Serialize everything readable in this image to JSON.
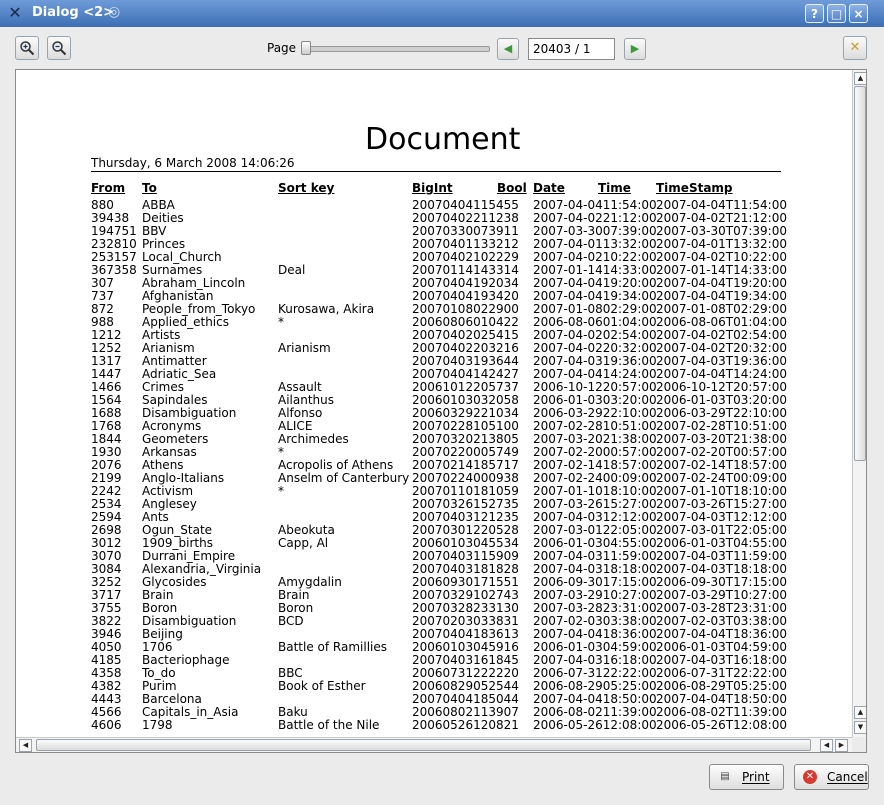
{
  "window": {
    "title": "Dialog <2>",
    "controls": [
      "?",
      "□",
      "×"
    ]
  },
  "toolbar": {
    "zoom_in_icon": "magnifier-plus-icon",
    "zoom_out_icon": "magnifier-minus-icon",
    "page_label": "Page",
    "page_value": "20403 / 1",
    "page_position": 0.0
  },
  "document": {
    "title": "Document",
    "date": "Thursday, 6 March 2008  14:06:26",
    "headers": {
      "from": "From",
      "to": "To",
      "sort": "Sort key",
      "bigint": "BigInt",
      "bool": "Bool",
      "date": "Date",
      "time": "Time",
      "timestamp": "TimeStamp"
    },
    "rows": [
      [
        "880",
        "ABBA",
        "",
        "20070404115455",
        "2007-04-0411:54:00",
        "2007-04-04T11:54:00"
      ],
      [
        "39438",
        "Deities",
        "",
        "20070402211238",
        "2007-04-0221:12:00",
        "2007-04-02T21:12:00"
      ],
      [
        "194751",
        "BBV",
        "",
        "20070330073911",
        "2007-03-3007:39:00",
        "2007-03-30T07:39:00"
      ],
      [
        "232810",
        "Princes",
        "",
        "20070401133212",
        "2007-04-0113:32:00",
        "2007-04-01T13:32:00"
      ],
      [
        "253157",
        "Local_Church",
        "",
        "20070402102229",
        "2007-04-0210:22:00",
        "2007-04-02T10:22:00"
      ],
      [
        "367358",
        "Surnames",
        "Deal",
        "20070114143314",
        "2007-01-1414:33:00",
        "2007-01-14T14:33:00"
      ],
      [
        "307",
        "Abraham_Lincoln",
        "",
        "20070404192034",
        "2007-04-0419:20:00",
        "2007-04-04T19:20:00"
      ],
      [
        "737",
        "Afghanistan",
        "",
        "20070404193420",
        "2007-04-0419:34:00",
        "2007-04-04T19:34:00"
      ],
      [
        "872",
        "People_from_Tokyo",
        "Kurosawa, Akira",
        "20070108022900",
        "2007-01-0802:29:00",
        "2007-01-08T02:29:00"
      ],
      [
        "988",
        "Applied_ethics",
        "*",
        "20060806010422",
        "2006-08-0601:04:00",
        "2006-08-06T01:04:00"
      ],
      [
        "1212",
        "Artists",
        "",
        "20070402025415",
        "2007-04-0202:54:00",
        "2007-04-02T02:54:00"
      ],
      [
        "1252",
        "Arianism",
        "Arianism",
        "20070402203216",
        "2007-04-0220:32:00",
        "2007-04-02T20:32:00"
      ],
      [
        "1317",
        "Antimatter",
        "",
        "20070403193644",
        "2007-04-0319:36:00",
        "2007-04-03T19:36:00"
      ],
      [
        "1447",
        "Adriatic_Sea",
        "",
        "20070404142427",
        "2007-04-0414:24:00",
        "2007-04-04T14:24:00"
      ],
      [
        "1466",
        "Crimes",
        "Assault",
        "20061012205737",
        "2006-10-1220:57:00",
        "2006-10-12T20:57:00"
      ],
      [
        "1564",
        "Sapindales",
        "Ailanthus",
        "20060103032058",
        "2006-01-0303:20:00",
        "2006-01-03T03:20:00"
      ],
      [
        "1688",
        "Disambiguation",
        "Alfonso",
        "20060329221034",
        "2006-03-2922:10:00",
        "2006-03-29T22:10:00"
      ],
      [
        "1768",
        "Acronyms",
        "ALICE",
        "20070228105100",
        "2007-02-2810:51:00",
        "2007-02-28T10:51:00"
      ],
      [
        "1844",
        "Geometers",
        "Archimedes",
        "20070320213805",
        "2007-03-2021:38:00",
        "2007-03-20T21:38:00"
      ],
      [
        "1930",
        "Arkansas",
        "*",
        "20070220005749",
        "2007-02-2000:57:00",
        "2007-02-20T00:57:00"
      ],
      [
        "2076",
        "Athens",
        "Acropolis of Athens",
        "20070214185717",
        "2007-02-1418:57:00",
        "2007-02-14T18:57:00"
      ],
      [
        "2199",
        "Anglo-Italians",
        "Anselm of Canterbury",
        "20070224000938",
        "2007-02-2400:09:00",
        "2007-02-24T00:09:00"
      ],
      [
        "2242",
        "Activism",
        "*",
        "20070110181059",
        "2007-01-1018:10:00",
        "2007-01-10T18:10:00"
      ],
      [
        "2534",
        "Anglesey",
        "",
        "20070326152735",
        "2007-03-2615:27:00",
        "2007-03-26T15:27:00"
      ],
      [
        "2594",
        "Ants",
        "",
        "20070403121235",
        "2007-04-0312:12:00",
        "2007-04-03T12:12:00"
      ],
      [
        "2698",
        "Ogun_State",
        "Abeokuta",
        "20070301220528",
        "2007-03-0122:05:00",
        "2007-03-01T22:05:00"
      ],
      [
        "3012",
        "1909_births",
        "Capp, Al",
        "20060103045534",
        "2006-01-0304:55:00",
        "2006-01-03T04:55:00"
      ],
      [
        "3070",
        "Durrani_Empire",
        "",
        "20070403115909",
        "2007-04-0311:59:00",
        "2007-04-03T11:59:00"
      ],
      [
        "3084",
        "Alexandria,_Virginia",
        "",
        "20070403181828",
        "2007-04-0318:18:00",
        "2007-04-03T18:18:00"
      ],
      [
        "3252",
        "Glycosides",
        "Amygdalin",
        "20060930171551",
        "2006-09-3017:15:00",
        "2006-09-30T17:15:00"
      ],
      [
        "3717",
        "Brain",
        "Brain",
        "20070329102743",
        "2007-03-2910:27:00",
        "2007-03-29T10:27:00"
      ],
      [
        "3755",
        "Boron",
        "Boron",
        "20070328233130",
        "2007-03-2823:31:00",
        "2007-03-28T23:31:00"
      ],
      [
        "3822",
        "Disambiguation",
        "BCD",
        "20070203033831",
        "2007-02-0303:38:00",
        "2007-02-03T03:38:00"
      ],
      [
        "3946",
        "Beijing",
        "",
        "20070404183613",
        "2007-04-0418:36:00",
        "2007-04-04T18:36:00"
      ],
      [
        "4050",
        "1706",
        "Battle of Ramillies",
        "20060103045916",
        "2006-01-0304:59:00",
        "2006-01-03T04:59:00"
      ],
      [
        "4185",
        "Bacteriophage",
        "",
        "20070403161845",
        "2007-04-0316:18:00",
        "2007-04-03T16:18:00"
      ],
      [
        "4358",
        "To_do",
        "BBC",
        "20060731222220",
        "2006-07-3122:22:00",
        "2006-07-31T22:22:00"
      ],
      [
        "4382",
        "Purim",
        "Book of Esther",
        "20060829052544",
        "2006-08-2905:25:00",
        "2006-08-29T05:25:00"
      ],
      [
        "4443",
        "Barcelona",
        "",
        "20070404185044",
        "2007-04-0418:50:00",
        "2007-04-04T18:50:00"
      ],
      [
        "4566",
        "Capitals_in_Asia",
        "Baku",
        "20060802113907",
        "2006-08-0211:39:00",
        "2006-08-02T11:39:00"
      ],
      [
        "4606",
        "1798",
        "Battle of the Nile",
        "20060526120821",
        "2006-05-2612:08:00",
        "2006-05-26T12:08:00"
      ]
    ]
  },
  "buttons": {
    "print": "Print",
    "cancel": "Cancel"
  }
}
